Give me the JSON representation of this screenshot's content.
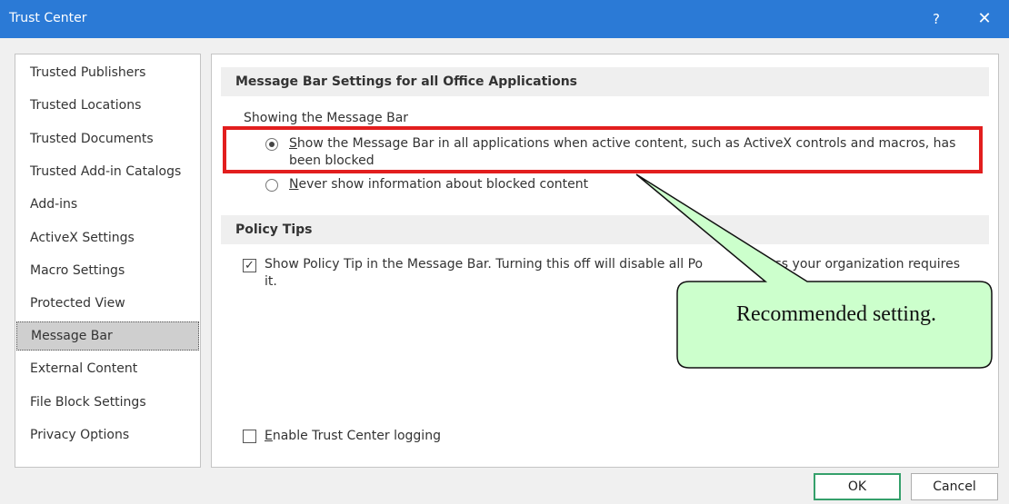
{
  "window": {
    "title": "Trust Center",
    "help_glyph": "?",
    "close_glyph": "✕"
  },
  "sidebar": {
    "items": [
      {
        "label": "Trusted Publishers"
      },
      {
        "label": "Trusted Locations"
      },
      {
        "label": "Trusted Documents"
      },
      {
        "label": "Trusted Add-in Catalogs"
      },
      {
        "label": "Add-ins"
      },
      {
        "label": "ActiveX Settings"
      },
      {
        "label": "Macro Settings"
      },
      {
        "label": "Protected View"
      },
      {
        "label": "Message Bar",
        "selected": true
      },
      {
        "label": "External Content"
      },
      {
        "label": "File Block Settings"
      },
      {
        "label": "Privacy Options"
      }
    ]
  },
  "main": {
    "message_bar_section": {
      "header": "Message Bar Settings for all Office Applications",
      "group_label": "Showing the Message Bar",
      "options": [
        {
          "underline_char": "S",
          "text_rest_line1": "how the Message Bar in all applications when active content, such as ActiveX controls and macros, has",
          "text_line2": "been blocked",
          "selected": true
        },
        {
          "underline_char": "N",
          "text_rest_line1": "ever show information about blocked content",
          "selected": false
        }
      ]
    },
    "policy_tips_section": {
      "header": "Policy Tips",
      "checkbox": {
        "checked": true,
        "check_glyph": "✓",
        "text_line1": "Show Policy Tip in the Message Bar. Turning this off will disable all Po",
        "text_line1_end": "nless your organization requires",
        "text_line2": "it."
      }
    },
    "logging_checkbox": {
      "checked": false,
      "underline_char": "E",
      "text_rest": "nable Trust Center logging"
    }
  },
  "annotation": {
    "callout_text": "Recommended setting.",
    "highlight_color": "#e21e1e",
    "callout_fill": "#ccffcc"
  },
  "footer": {
    "ok_label": "OK",
    "cancel_label": "Cancel"
  },
  "colors": {
    "titlebar": "#2b7ad6",
    "ok_border": "#35a06b"
  }
}
